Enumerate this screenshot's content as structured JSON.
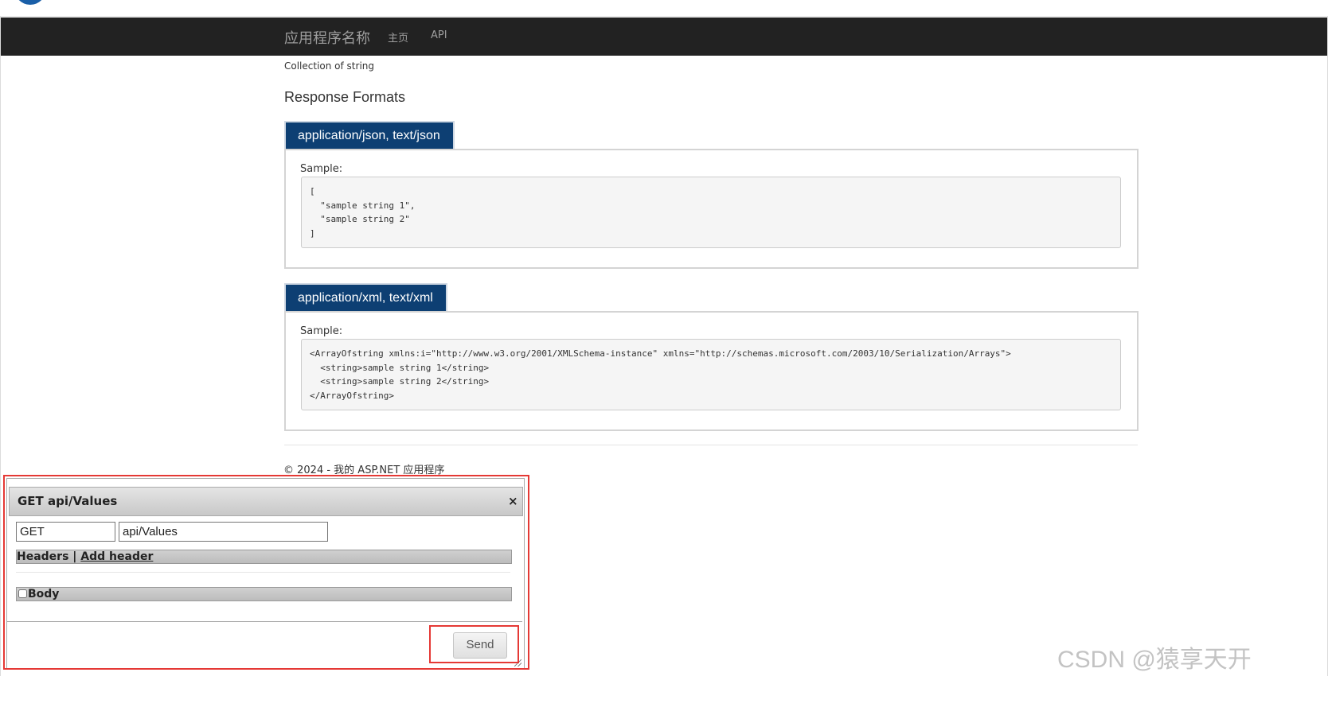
{
  "nav": {
    "brand": "应用程序名称",
    "links": [
      "主页",
      "API"
    ]
  },
  "description": "Collection of string",
  "section_title": "Response Formats",
  "formats": [
    {
      "tab": "application/json, text/json",
      "sample_label": "Sample:",
      "sample": "[\n  \"sample string 1\",\n  \"sample string 2\"\n]"
    },
    {
      "tab": "application/xml, text/xml",
      "sample_label": "Sample:",
      "sample": "<ArrayOfstring xmlns:i=\"http://www.w3.org/2001/XMLSchema-instance\" xmlns=\"http://schemas.microsoft.com/2003/10/Serialization/Arrays\">\n  <string>sample string 1</string>\n  <string>sample string 2</string>\n</ArrayOfstring>"
    }
  ],
  "footer": "© 2024 - 我的 ASP.NET 应用程序",
  "dialog": {
    "title": "GET api/Values",
    "close": "×",
    "method": "GET",
    "url": "api/Values",
    "headers_label": "Headers",
    "headers_sep": " | ",
    "add_header": "Add header",
    "body_label": "Body",
    "send_label": "Send"
  },
  "watermark": "CSDN @猿享天开",
  "colors": {
    "navbar": "#222222",
    "tab": "#0d3f73",
    "highlight": "#e53935"
  }
}
